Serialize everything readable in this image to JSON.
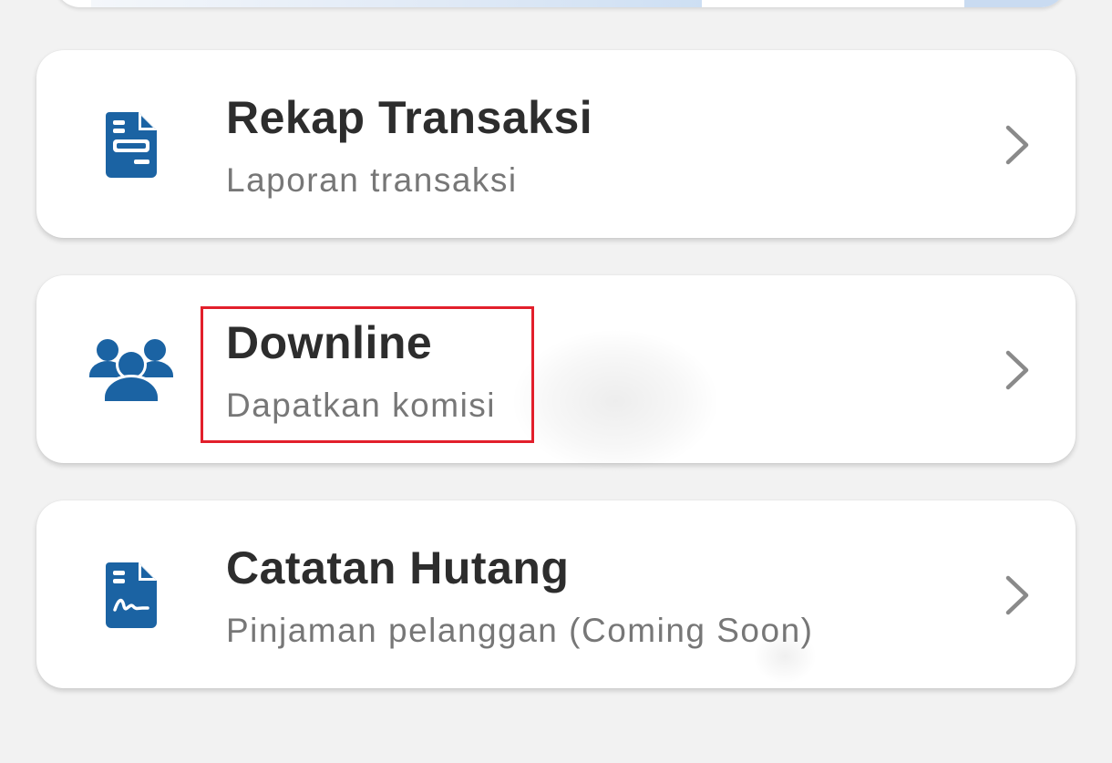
{
  "menu": {
    "items": [
      {
        "title": "Rekap Transaksi",
        "subtitle": "Laporan transaksi",
        "icon": "document-receipt-icon"
      },
      {
        "title": "Downline",
        "subtitle": "Dapatkan komisi",
        "icon": "group-users-icon"
      },
      {
        "title": "Catatan Hutang",
        "subtitle": "Pinjaman pelanggan (Coming Soon)",
        "icon": "signed-document-icon"
      }
    ]
  },
  "colors": {
    "icon": "#1b63a3",
    "title": "#2d2d2d",
    "subtitle": "#777777",
    "chevron": "#8a8a8a",
    "highlight": "#e21f2b",
    "background": "#f2f2f2",
    "card": "#ffffff"
  }
}
